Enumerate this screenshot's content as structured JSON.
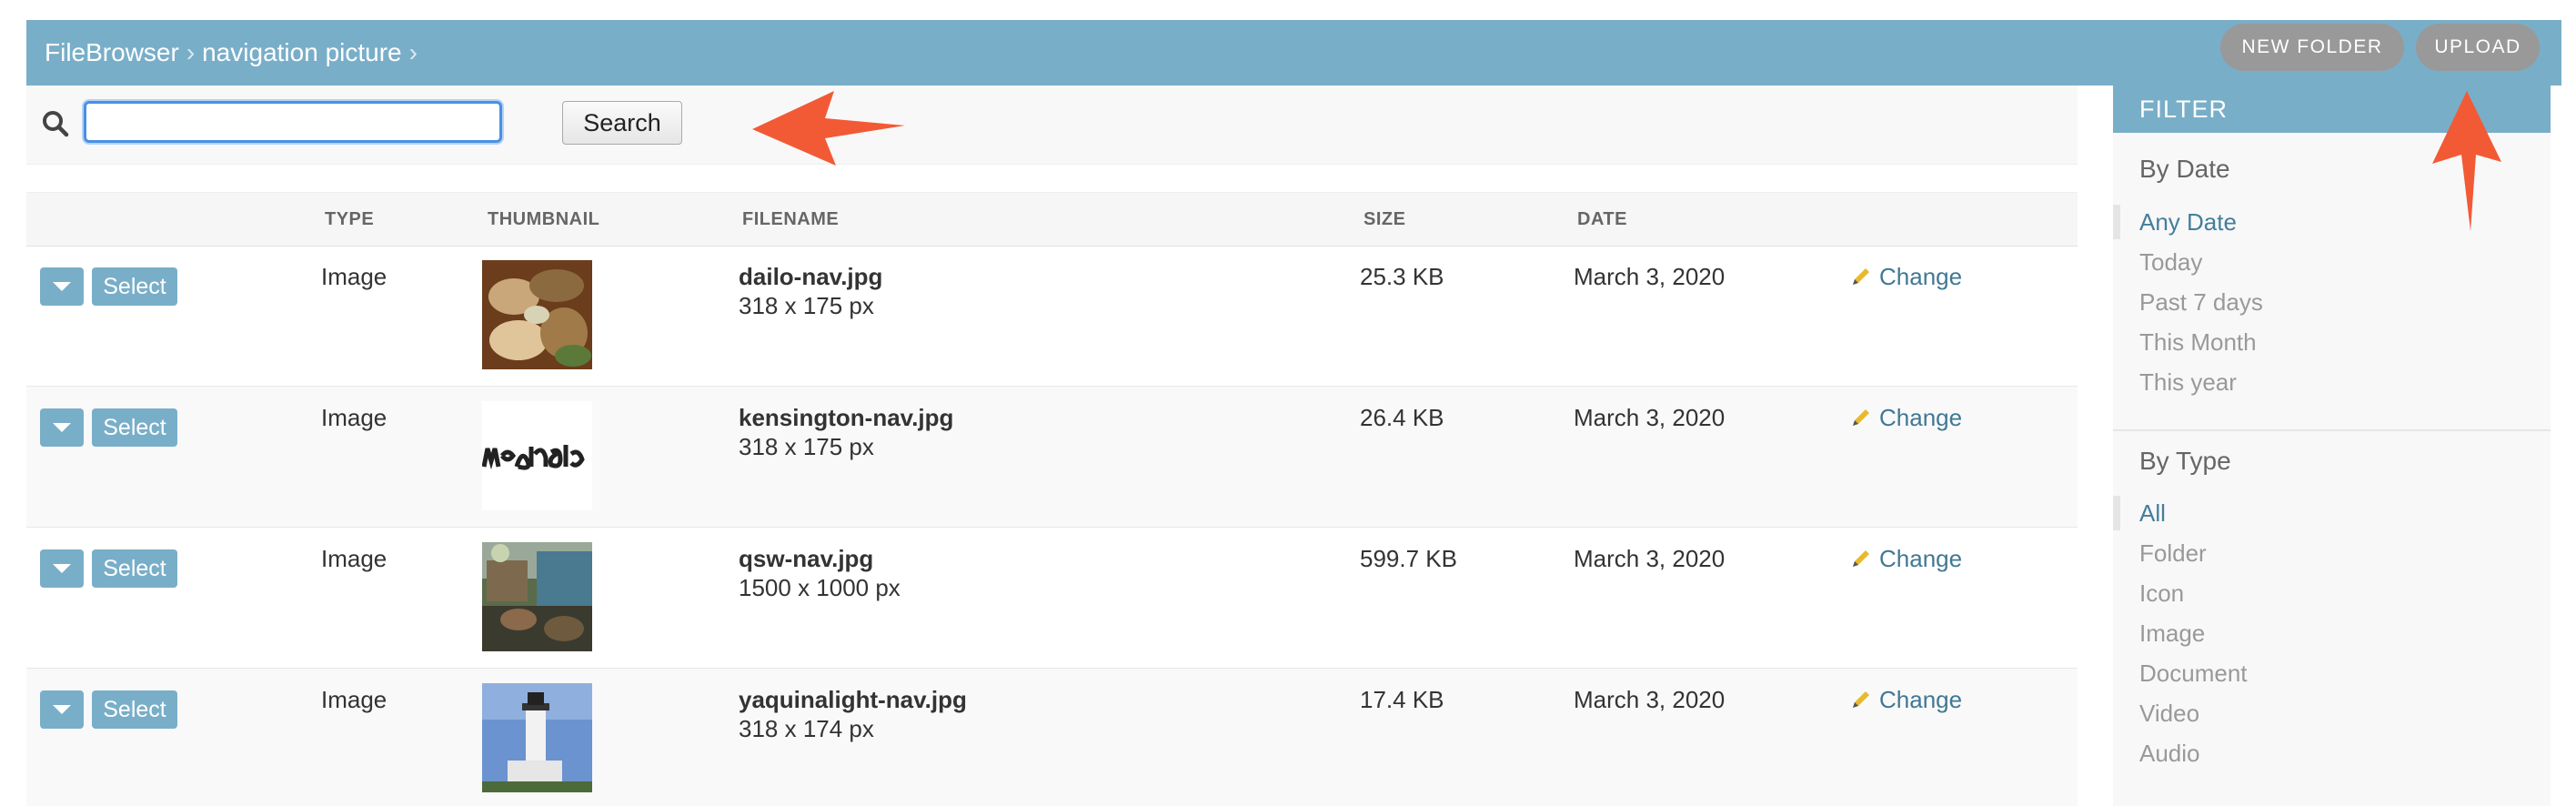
{
  "header": {
    "breadcrumbs": [
      "FileBrowser",
      "navigation picture"
    ],
    "separator": "›",
    "new_folder_label": "NEW FOLDER",
    "upload_label": "UPLOAD"
  },
  "search": {
    "value": "",
    "button_label": "Search"
  },
  "table": {
    "columns": [
      "TYPE",
      "THUMBNAIL",
      "FILENAME",
      "SIZE",
      "DATE"
    ],
    "select_label": "Select",
    "change_label": "Change",
    "rows": [
      {
        "type": "Image",
        "filename": "dailo-nav.jpg",
        "dimensions": "318 x 175 px",
        "size": "25.3 KB",
        "date": "March 3, 2020",
        "thumb": "food"
      },
      {
        "type": "Image",
        "filename": "kensington-nav.jpg",
        "dimensions": "318 x 175 px",
        "size": "26.4 KB",
        "date": "March 3, 2020",
        "thumb": "logo-text"
      },
      {
        "type": "Image",
        "filename": "qsw-nav.jpg",
        "dimensions": "1500 x 1000 px",
        "size": "599.7 KB",
        "date": "March 3, 2020",
        "thumb": "restaurant"
      },
      {
        "type": "Image",
        "filename": "yaquinalight-nav.jpg",
        "dimensions": "318 x 174 px",
        "size": "17.4 KB",
        "date": "March 3, 2020",
        "thumb": "lighthouse"
      }
    ]
  },
  "sidebar": {
    "title": "FILTER",
    "by_date": {
      "title": "By Date",
      "items": [
        "Any Date",
        "Today",
        "Past 7 days",
        "This Month",
        "This year"
      ],
      "selected": "Any Date"
    },
    "by_type": {
      "title": "By Type",
      "items": [
        "All",
        "Folder",
        "Icon",
        "Image",
        "Document",
        "Video",
        "Audio"
      ],
      "selected": "All"
    }
  },
  "colors": {
    "header": "#79aec8",
    "link": "#447e9b",
    "annotation_arrow": "#f25a35"
  },
  "icons": [
    "search-icon",
    "chevron-down-icon",
    "pencil-icon",
    "arrow-annotation-icon"
  ]
}
